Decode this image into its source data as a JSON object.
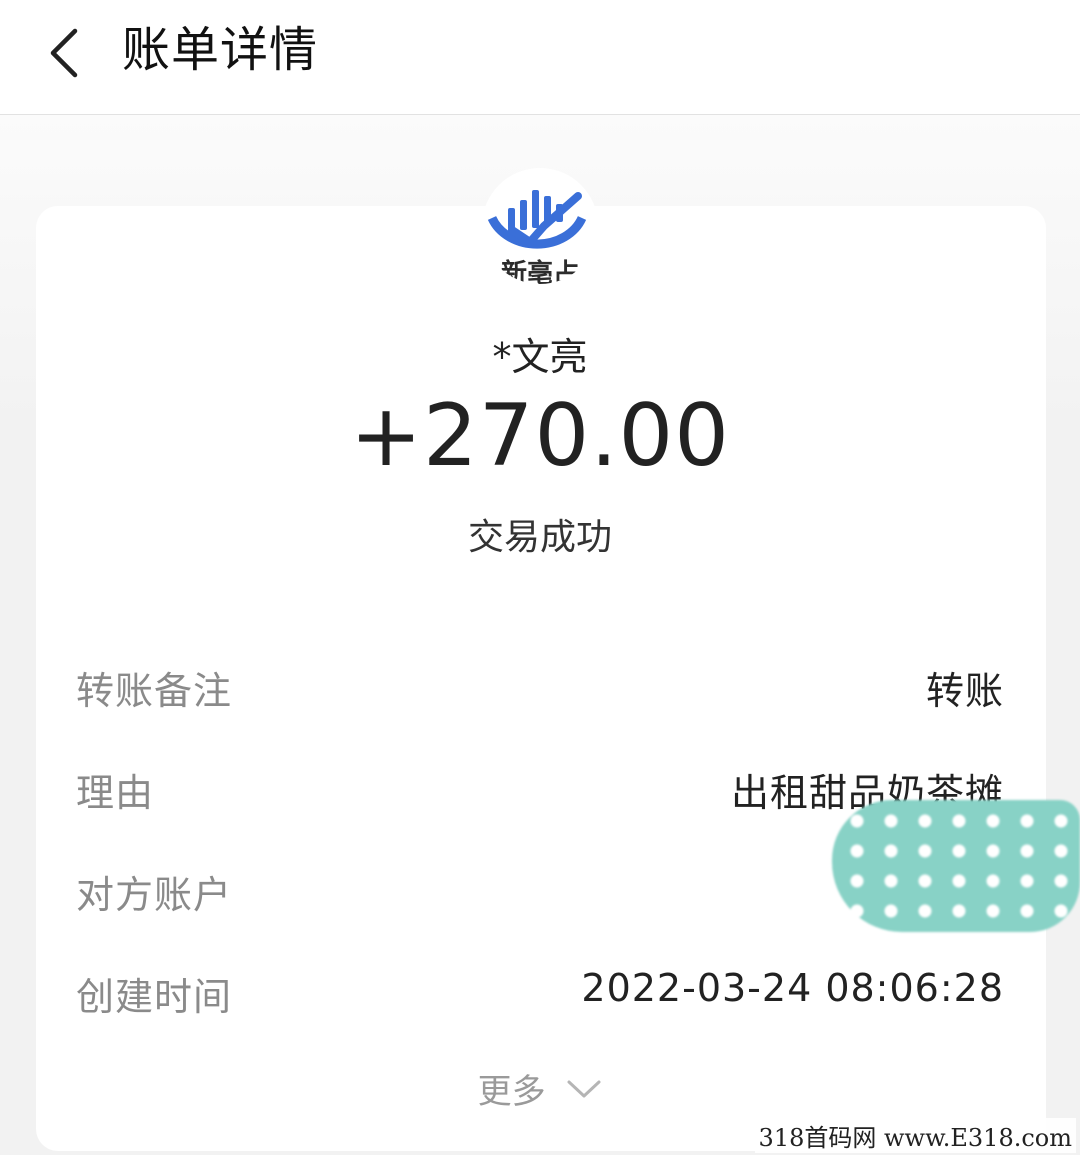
{
  "header": {
    "back_icon": "chevron-left-icon",
    "title": "账单详情"
  },
  "colors": {
    "logo_blue": "#3a6fd8",
    "mask_teal": "#88d2c6"
  },
  "summary": {
    "logo_icon": "bar-chart-check-logo-icon",
    "logo_text": "新亳占",
    "payer_name": "*文亮",
    "amount": "+270.00",
    "status": "交易成功"
  },
  "details": [
    {
      "label": "转账备注",
      "value": "转账"
    },
    {
      "label": "理由",
      "value": "出租甜品奶茶摊"
    },
    {
      "label": "对方账户",
      "value": ""
    },
    {
      "label": "创建时间",
      "value": "2022-03-24 08:06:28"
    }
  ],
  "more": {
    "label": "更多",
    "icon": "chevron-down-icon"
  },
  "watermark": "318首码网 www.E318.com"
}
